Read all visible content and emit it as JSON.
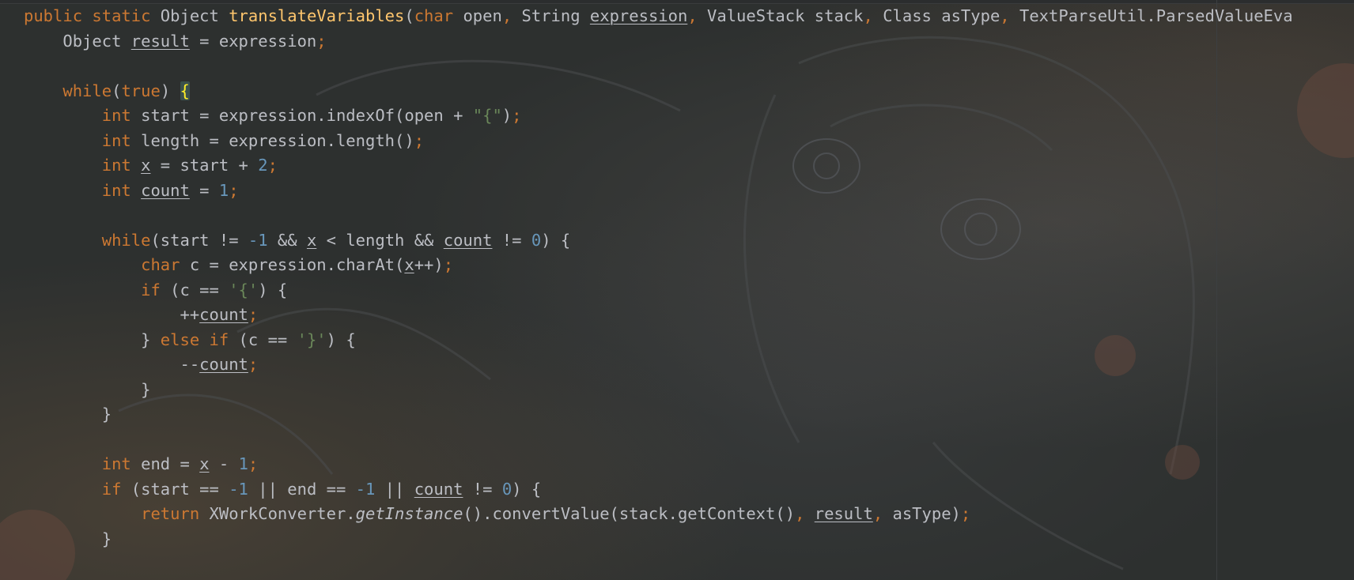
{
  "editor": {
    "language": "Java",
    "colors": {
      "background": "#2d302f",
      "keyword": "#cc7832",
      "string": "#6a8759",
      "number": "#6897bb",
      "method_declaration": "#ffc66d",
      "identifier": "#bcbec4",
      "matched_brace": "#ffef28"
    },
    "lines": [
      {
        "segments": [
          {
            "t": "public static ",
            "c": "k"
          },
          {
            "t": "Object ",
            "c": ""
          },
          {
            "t": "translateVariables",
            "c": "f"
          },
          {
            "t": "(",
            "c": ""
          },
          {
            "t": "char ",
            "c": "k"
          },
          {
            "t": "open",
            "c": ""
          },
          {
            "t": ", ",
            "c": "k"
          },
          {
            "t": "String ",
            "c": ""
          },
          {
            "t": "expression",
            "c": "u"
          },
          {
            "t": ", ",
            "c": "k"
          },
          {
            "t": "ValueStack stack",
            "c": ""
          },
          {
            "t": ", ",
            "c": "k"
          },
          {
            "t": "Class asType",
            "c": ""
          },
          {
            "t": ", ",
            "c": "k"
          },
          {
            "t": "TextParseUtil.ParsedValueEva",
            "c": ""
          }
        ]
      },
      {
        "segments": [
          {
            "t": "    Object ",
            "c": ""
          },
          {
            "t": "result",
            "c": "u"
          },
          {
            "t": " = expression",
            "c": ""
          },
          {
            "t": ";",
            "c": "k"
          }
        ]
      },
      {
        "segments": []
      },
      {
        "segments": [
          {
            "t": "    ",
            "c": ""
          },
          {
            "t": "while",
            "c": "k"
          },
          {
            "t": "(",
            "c": ""
          },
          {
            "t": "true",
            "c": "k"
          },
          {
            "t": ") ",
            "c": ""
          },
          {
            "t": "{",
            "c": "brace-hl"
          }
        ]
      },
      {
        "segments": [
          {
            "t": "        ",
            "c": ""
          },
          {
            "t": "int ",
            "c": "k"
          },
          {
            "t": "start = expression.indexOf(open + ",
            "c": ""
          },
          {
            "t": "\"{\"",
            "c": "s"
          },
          {
            "t": ")",
            "c": ""
          },
          {
            "t": ";",
            "c": "k"
          }
        ]
      },
      {
        "segments": [
          {
            "t": "        ",
            "c": ""
          },
          {
            "t": "int ",
            "c": "k"
          },
          {
            "t": "length = expression.length()",
            "c": ""
          },
          {
            "t": ";",
            "c": "k"
          }
        ]
      },
      {
        "segments": [
          {
            "t": "        ",
            "c": ""
          },
          {
            "t": "int ",
            "c": "k"
          },
          {
            "t": "x",
            "c": "u"
          },
          {
            "t": " = start + ",
            "c": ""
          },
          {
            "t": "2",
            "c": "n"
          },
          {
            "t": ";",
            "c": "k"
          }
        ]
      },
      {
        "segments": [
          {
            "t": "        ",
            "c": ""
          },
          {
            "t": "int ",
            "c": "k"
          },
          {
            "t": "count",
            "c": "u"
          },
          {
            "t": " = ",
            "c": ""
          },
          {
            "t": "1",
            "c": "n"
          },
          {
            "t": ";",
            "c": "k"
          }
        ]
      },
      {
        "segments": []
      },
      {
        "segments": [
          {
            "t": "        ",
            "c": ""
          },
          {
            "t": "while",
            "c": "k"
          },
          {
            "t": "(start != ",
            "c": ""
          },
          {
            "t": "-1",
            "c": "n"
          },
          {
            "t": " && ",
            "c": ""
          },
          {
            "t": "x",
            "c": "u"
          },
          {
            "t": " < length && ",
            "c": ""
          },
          {
            "t": "count",
            "c": "u"
          },
          {
            "t": " != ",
            "c": ""
          },
          {
            "t": "0",
            "c": "n"
          },
          {
            "t": ") {",
            "c": ""
          }
        ]
      },
      {
        "segments": [
          {
            "t": "            ",
            "c": ""
          },
          {
            "t": "char ",
            "c": "k"
          },
          {
            "t": "c = expression.charAt(",
            "c": ""
          },
          {
            "t": "x",
            "c": "u"
          },
          {
            "t": "++)",
            "c": ""
          },
          {
            "t": ";",
            "c": "k"
          }
        ]
      },
      {
        "segments": [
          {
            "t": "            ",
            "c": ""
          },
          {
            "t": "if ",
            "c": "k"
          },
          {
            "t": "(c == ",
            "c": ""
          },
          {
            "t": "'{'",
            "c": "s"
          },
          {
            "t": ") {",
            "c": ""
          }
        ]
      },
      {
        "segments": [
          {
            "t": "                ++",
            "c": ""
          },
          {
            "t": "count",
            "c": "u"
          },
          {
            "t": ";",
            "c": "k"
          }
        ]
      },
      {
        "segments": [
          {
            "t": "            } ",
            "c": ""
          },
          {
            "t": "else if ",
            "c": "k"
          },
          {
            "t": "(c == ",
            "c": ""
          },
          {
            "t": "'}'",
            "c": "s"
          },
          {
            "t": ") {",
            "c": ""
          }
        ]
      },
      {
        "segments": [
          {
            "t": "                --",
            "c": ""
          },
          {
            "t": "count",
            "c": "u"
          },
          {
            "t": ";",
            "c": "k"
          }
        ]
      },
      {
        "segments": [
          {
            "t": "            }",
            "c": ""
          }
        ]
      },
      {
        "segments": [
          {
            "t": "        }",
            "c": ""
          }
        ]
      },
      {
        "segments": []
      },
      {
        "segments": [
          {
            "t": "        ",
            "c": ""
          },
          {
            "t": "int ",
            "c": "k"
          },
          {
            "t": "end = ",
            "c": ""
          },
          {
            "t": "x",
            "c": "u"
          },
          {
            "t": " - ",
            "c": ""
          },
          {
            "t": "1",
            "c": "n"
          },
          {
            "t": ";",
            "c": "k"
          }
        ]
      },
      {
        "segments": [
          {
            "t": "        ",
            "c": ""
          },
          {
            "t": "if ",
            "c": "k"
          },
          {
            "t": "(start == ",
            "c": ""
          },
          {
            "t": "-1",
            "c": "n"
          },
          {
            "t": " || end == ",
            "c": ""
          },
          {
            "t": "-1",
            "c": "n"
          },
          {
            "t": " || ",
            "c": ""
          },
          {
            "t": "count",
            "c": "u"
          },
          {
            "t": " != ",
            "c": ""
          },
          {
            "t": "0",
            "c": "n"
          },
          {
            "t": ") {",
            "c": ""
          }
        ]
      },
      {
        "segments": [
          {
            "t": "            ",
            "c": ""
          },
          {
            "t": "return ",
            "c": "k"
          },
          {
            "t": "XWorkConverter.",
            "c": ""
          },
          {
            "t": "getInstance",
            "c": "i"
          },
          {
            "t": "().convertValue(stack.getContext()",
            "c": ""
          },
          {
            "t": ", ",
            "c": "k"
          },
          {
            "t": "result",
            "c": "u"
          },
          {
            "t": ", ",
            "c": "k"
          },
          {
            "t": "asType)",
            "c": ""
          },
          {
            "t": ";",
            "c": "k"
          }
        ]
      },
      {
        "segments": [
          {
            "t": "        }",
            "c": ""
          }
        ]
      }
    ]
  }
}
